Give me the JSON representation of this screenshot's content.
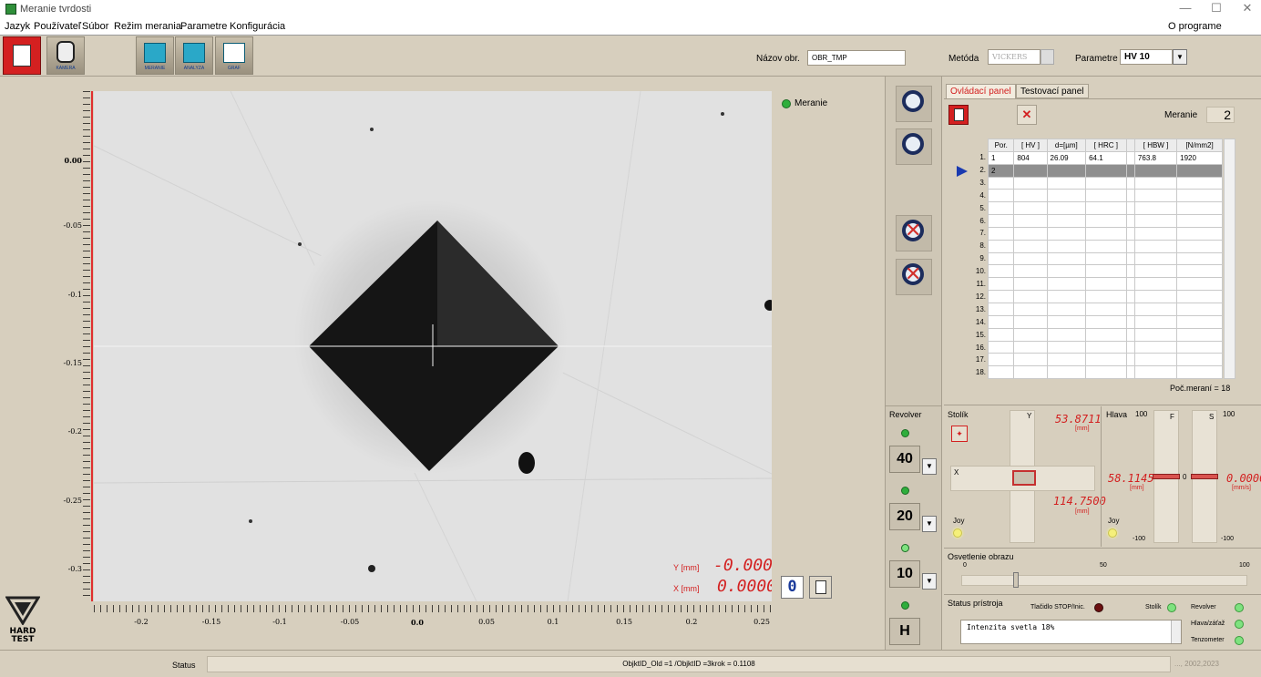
{
  "window": {
    "title": "Meranie tvrdosti",
    "minimize": "—",
    "maximize": "☐",
    "close": "✕"
  },
  "menu": {
    "items": [
      "Jazyk",
      "Používateľ",
      "Súbor",
      "Režim merania",
      "Parametre",
      "Konfigurácia"
    ],
    "about": "O programe"
  },
  "toolbar": {
    "buttons": [
      {
        "caption": ""
      },
      {
        "caption": "KAMERA"
      },
      {
        "caption": "MERANIE"
      },
      {
        "caption": "ANALYZA"
      },
      {
        "caption": "GRAF"
      }
    ],
    "image_name_label": "Názov obr.",
    "image_name_value": "OBR_TMP",
    "method_label": "Metóda",
    "method_value": "VICKERS",
    "param_label": "Parametre",
    "param_value": "HV  10"
  },
  "image": {
    "indicator_label": "Meranie",
    "y_axis_ticks": [
      "0.00",
      "-0.05",
      "-0.1",
      "-0.15",
      "-0.2",
      "-0.25",
      "-0.3"
    ],
    "x_axis_ticks": [
      "-0.2",
      "-0.15",
      "-0.1",
      "-0.05",
      "0.0",
      "0.05",
      "0.1",
      "0.15",
      "0.2",
      "0.25"
    ],
    "y_readout_label": "Y [mm]",
    "y_readout_value": "-0.0000",
    "x_readout_label": "X [mm]",
    "x_readout_value": "0.0000",
    "small_digit": "0"
  },
  "revolver": {
    "label": "Revolver",
    "positions": [
      "40",
      "20",
      "10",
      "H"
    ]
  },
  "panel": {
    "tabs": [
      "Ovládací panel",
      "Testovací panel"
    ],
    "measure_label": "Meranie",
    "measure_value": "2",
    "table": {
      "headers": [
        "Por.",
        "[ HV ]",
        "d=[µm]",
        "[ HRC ]",
        "",
        "[ HBW ]",
        "[N/mm2]"
      ],
      "rows": [
        [
          "1",
          "804",
          "26.09",
          "64.1",
          "",
          "763.8",
          "1920"
        ],
        [
          "2",
          "",
          "",
          "",
          "",
          "",
          ""
        ]
      ],
      "row_numbers": [
        "1.",
        "2.",
        "3.",
        "4.",
        "5.",
        "6.",
        "7.",
        "8.",
        "9.",
        "10.",
        "11.",
        "12.",
        "13.",
        "14.",
        "15.",
        "16.",
        "17.",
        "18."
      ]
    },
    "count_label": "Poč.meraní = 18"
  },
  "stage": {
    "label": "Stolík",
    "y_label": "Y",
    "x_label": "X",
    "y_value": "53.8711",
    "x_value": "114.7500",
    "unit": "[mm]",
    "joy": "Joy"
  },
  "head": {
    "label": "Hlava",
    "f_label": "F",
    "s_label": "S",
    "scale_max": "100",
    "scale_min": "-100",
    "zero": "0",
    "f_value": "58.1145",
    "f_unit": "[mm]",
    "s_value": "0.0000",
    "s_unit": "[mm/s]",
    "joy": "Joy"
  },
  "illumination": {
    "label": "Osvetlenie obrazu",
    "scale": [
      "0",
      "50",
      "100"
    ],
    "level_fraction": 0.18
  },
  "instrument_status": {
    "label": "Status prístroja",
    "stop_label": "Tlačidlo STOP/Inic.",
    "stage_label": "Stolík",
    "revolver_label": "Revolver",
    "head_label": "Hlava/záťaž",
    "tenso_label": "Tenzometer",
    "message": "Intenzita svetla 18%"
  },
  "statusbar": {
    "label": "Status",
    "text": "ObjktID_Old =1 /ObjktID =3krok = 0.1108",
    "copyright": "..., 2002,2023"
  },
  "logo": {
    "text": "HARD TEST"
  },
  "colors": {
    "accent_red": "#d32020",
    "led_green": "#2fae3c",
    "bg": "#d7cfbe"
  }
}
